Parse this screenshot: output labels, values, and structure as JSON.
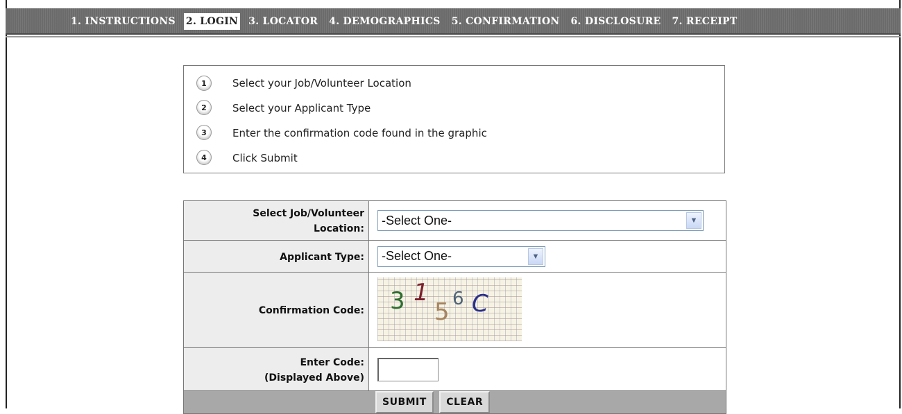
{
  "tabs": [
    {
      "label": "1. INSTRUCTIONS"
    },
    {
      "label": "2. LOGIN"
    },
    {
      "label": "3. LOCATOR"
    },
    {
      "label": "4. DEMOGRAPHICS"
    },
    {
      "label": "5. CONFIRMATION"
    },
    {
      "label": "6. DISCLOSURE"
    },
    {
      "label": "7. RECEIPT"
    }
  ],
  "active_tab": "2. LOGIN",
  "steps": [
    {
      "number": "1",
      "text": "Select your Job/Volunteer Location"
    },
    {
      "number": "2",
      "text": "Select your Applicant Type"
    },
    {
      "number": "3",
      "text": "Enter the confirmation code found in the graphic"
    },
    {
      "number": "4",
      "text": "Click Submit"
    }
  ],
  "form": {
    "location_label_line1": "Select Job/Volunteer",
    "location_label_line2": "Location:",
    "location_value": "-Select One-",
    "applicant_label": "Applicant Type:",
    "applicant_value": "-Select One-",
    "confirmation_label": "Confirmation Code:",
    "captcha_chars": [
      {
        "char": "3",
        "color": "#2e6e2e"
      },
      {
        "char": "1",
        "color": "#7a1f2b"
      },
      {
        "char": "5",
        "color": "#a7845e"
      },
      {
        "char": "6",
        "color": "#4f6478"
      },
      {
        "char": "C",
        "color": "#2b2f8a"
      }
    ],
    "enter_code_label_line1": "Enter Code:",
    "enter_code_label_line2": "(Displayed Above)",
    "enter_code_value": "",
    "submit_label": "SUBMIT",
    "clear_label": "CLEAR"
  },
  "icons": {
    "dropdown": "chevron-down-icon"
  }
}
